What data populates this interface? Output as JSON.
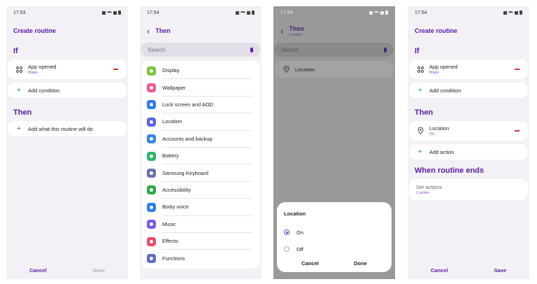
{
  "status": {
    "time1": "17:53",
    "time2": "17:54",
    "time3": "17:54",
    "time4": "17:54"
  },
  "screen1": {
    "title": "Create routine",
    "if_label": "If",
    "condition": {
      "name": "App opened",
      "detail": "Maps"
    },
    "add_condition": "Add condition",
    "then_label": "Then",
    "add_action": "Add what this routine will do",
    "cancel": "Cancel",
    "save": "Save"
  },
  "screen2": {
    "title": "Then",
    "search_placeholder": "Search",
    "items": [
      {
        "label": "Display",
        "color": "#7cc43c",
        "icon": "display-icon"
      },
      {
        "label": "Wallpaper",
        "color": "#ee5b8a",
        "icon": "wallpaper-icon"
      },
      {
        "label": "Lock screen and AOD",
        "color": "#2f7ee8",
        "icon": "lock-icon"
      },
      {
        "label": "Location",
        "color": "#5a64e0",
        "icon": "location-icon"
      },
      {
        "label": "Accounts and backup",
        "color": "#3a84e6",
        "icon": "sync-icon"
      },
      {
        "label": "Battery",
        "color": "#2db46a",
        "icon": "battery-icon"
      },
      {
        "label": "Samsung Keyboard",
        "color": "#6e6ea8",
        "icon": "keyboard-icon"
      },
      {
        "label": "Accessibility",
        "color": "#2fa84a",
        "icon": "accessibility-icon"
      },
      {
        "label": "Bixby voice",
        "color": "#2f7ee8",
        "icon": "bixby-icon"
      },
      {
        "label": "Music",
        "color": "#7a5ce0",
        "icon": "music-icon"
      },
      {
        "label": "Effects",
        "color": "#e94a6d",
        "icon": "effects-icon"
      },
      {
        "label": "Functions",
        "color": "#5d6cc0",
        "icon": "gear-icon"
      }
    ]
  },
  "screen3": {
    "title": "Then",
    "subtitle": "Location",
    "search_placeholder": "Search",
    "result": "Location",
    "dialog": {
      "title": "Location",
      "option_on": "On",
      "option_off": "Off",
      "cancel": "Cancel",
      "done": "Done"
    }
  },
  "screen4": {
    "title": "Create routine",
    "if_label": "If",
    "condition": {
      "name": "App opened",
      "detail": "Maps"
    },
    "add_condition": "Add condition",
    "then_label": "Then",
    "action": {
      "name": "Location",
      "detail": "On"
    },
    "add_action": "Add action",
    "ends_label": "When routine ends",
    "set_actions": "Set actions",
    "set_actions_count": "1 action",
    "cancel": "Cancel",
    "save": "Save"
  }
}
